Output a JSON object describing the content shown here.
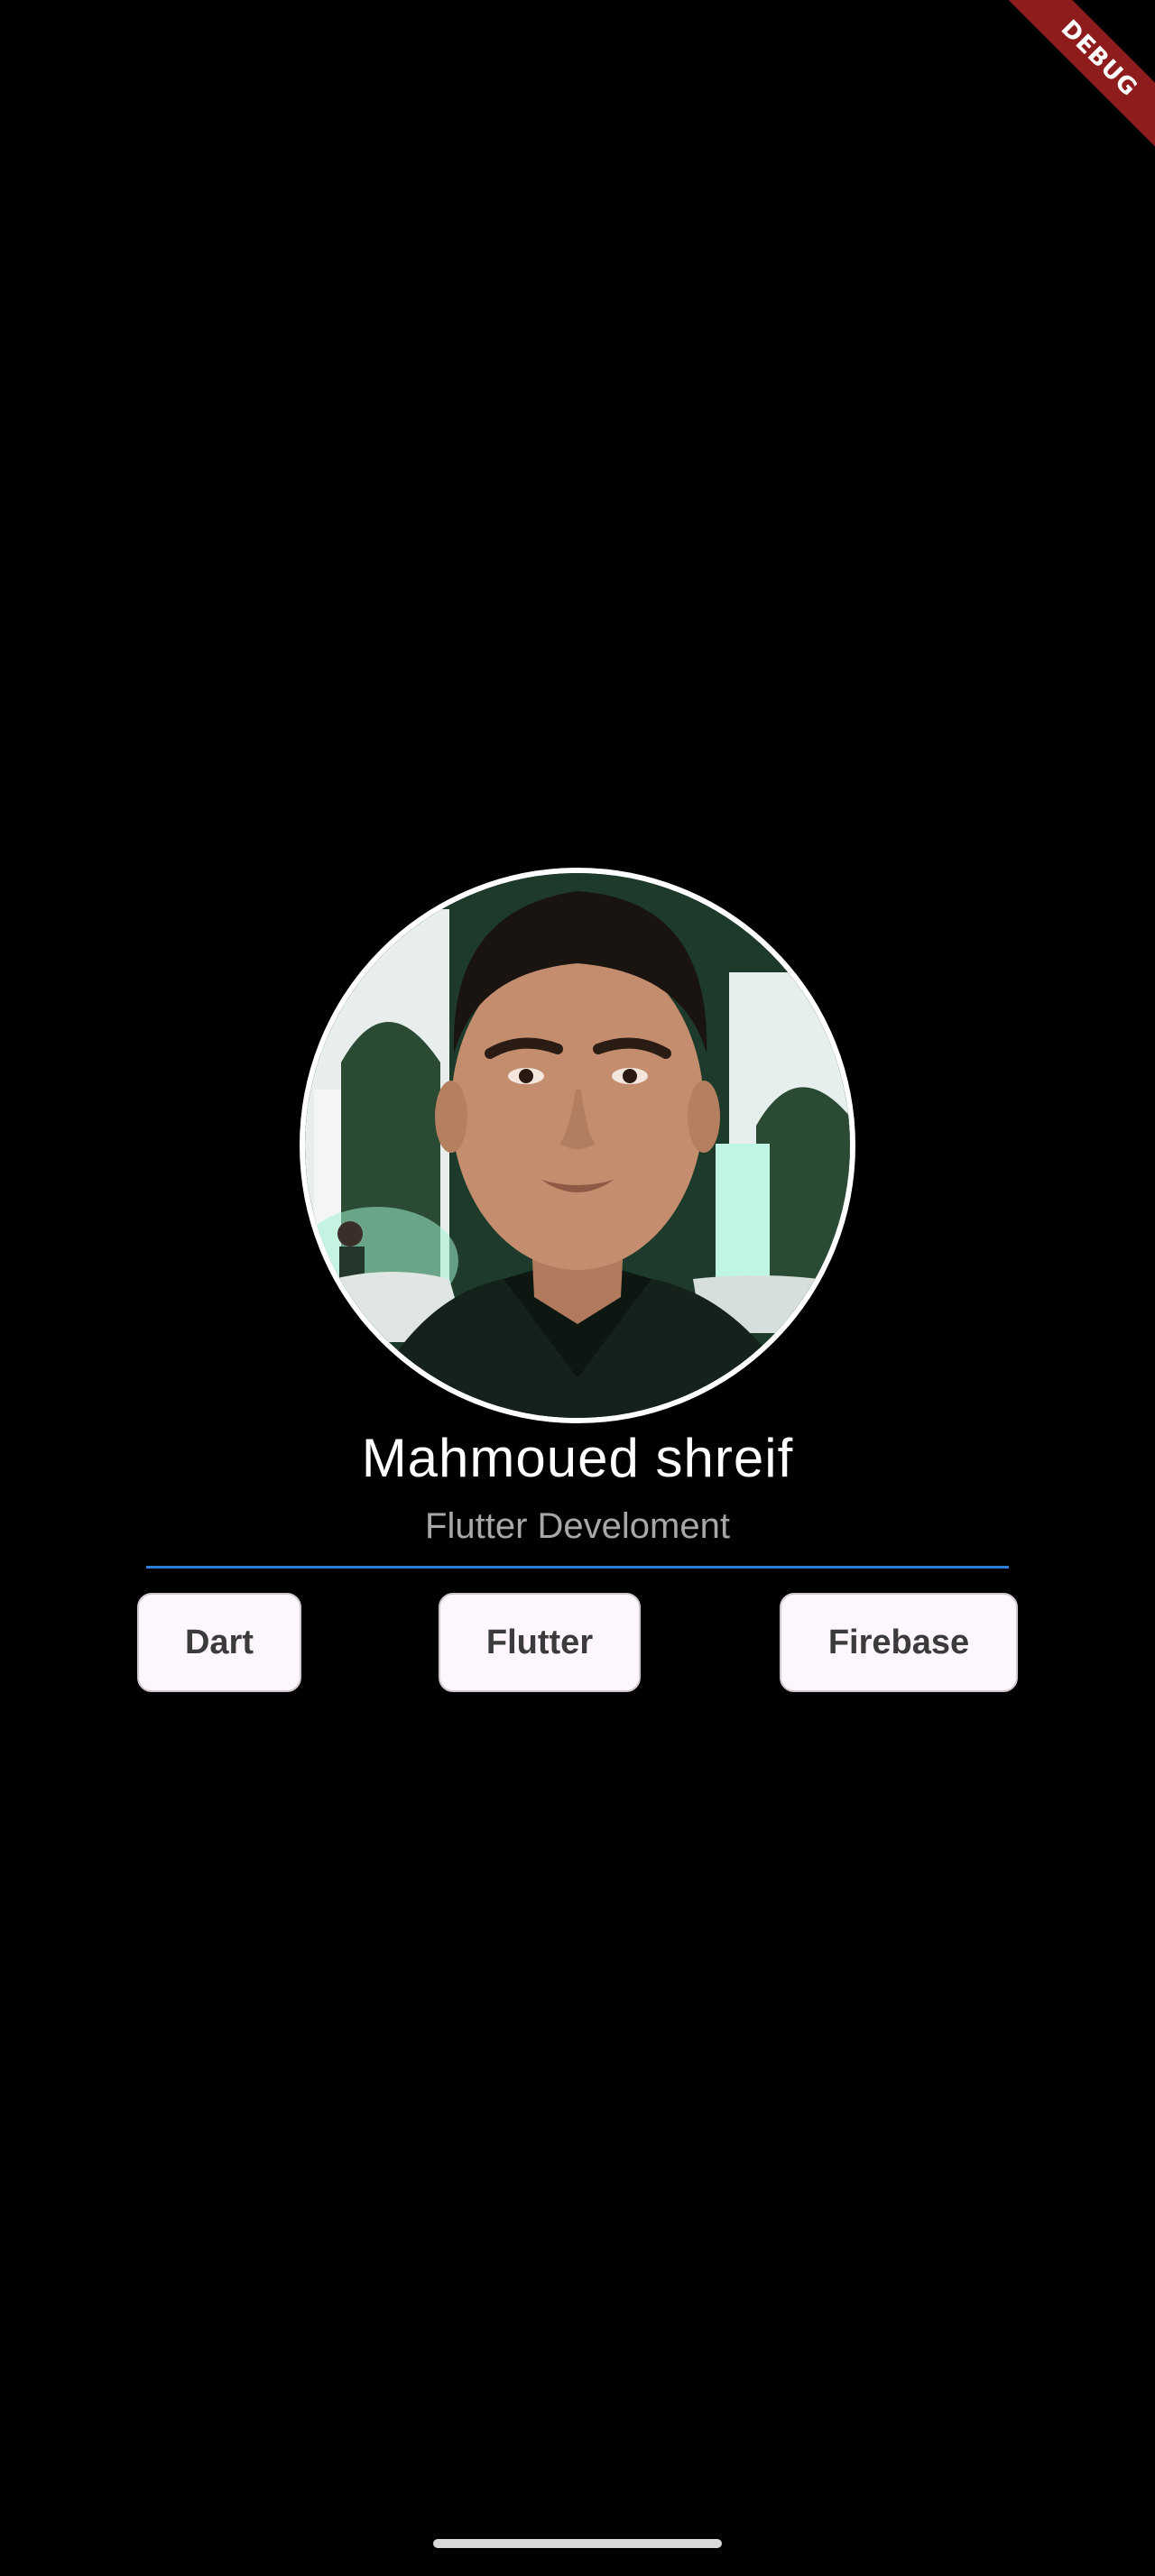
{
  "debug_banner": {
    "label": "DEBUG",
    "color": "#8e1c1c"
  },
  "profile": {
    "name": "Mahmoued shreif",
    "title": "Flutter Develoment",
    "avatar_icon": "profile-photo"
  },
  "skills": [
    {
      "label": "Dart"
    },
    {
      "label": "Flutter"
    },
    {
      "label": "Firebase"
    }
  ],
  "colors": {
    "background": "#000000",
    "divider": "#2f7fd6",
    "chip_background": "#fdf7fd",
    "chip_text": "#3b3b3b"
  }
}
